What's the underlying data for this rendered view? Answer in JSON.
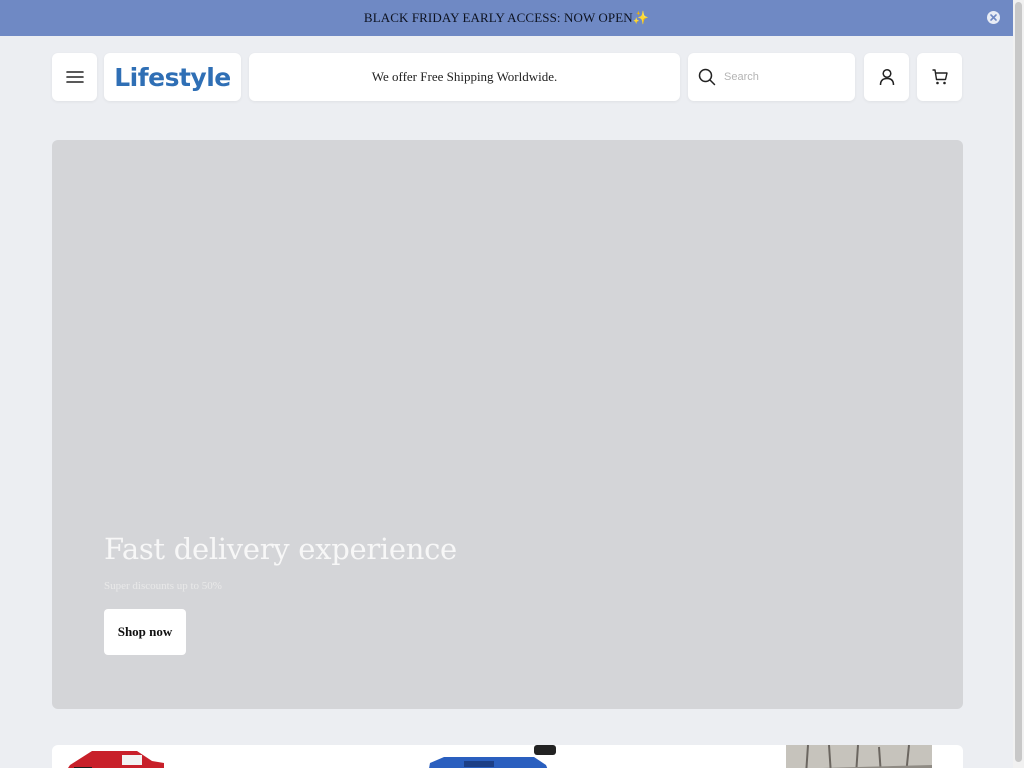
{
  "announcement": {
    "text": "BLACK FRIDAY EARLY ACCESS: NOW OPEN✨",
    "close_icon": "close-circle-icon",
    "bg_color": "#6f89c4"
  },
  "header": {
    "menu_icon": "hamburger-menu-icon",
    "logo_text": "Lifestyle",
    "shipping_text": "We offer Free Shipping Worldwide.",
    "search": {
      "placeholder": "Search",
      "value": "",
      "icon": "search-icon"
    },
    "account_icon": "user-icon",
    "cart_icon": "cart-icon"
  },
  "hero": {
    "title": "Fast delivery experience",
    "subtitle": "Super discounts up to 50%",
    "cta_label": "Shop now",
    "bg_color": "#d4d5d8"
  },
  "products": {
    "items": [
      {
        "name": "product-red",
        "color": "#c8202a"
      },
      {
        "name": "product-blue",
        "color": "#2a5fbf"
      },
      {
        "name": "product-photo",
        "color": "#b9b5ae"
      }
    ]
  }
}
